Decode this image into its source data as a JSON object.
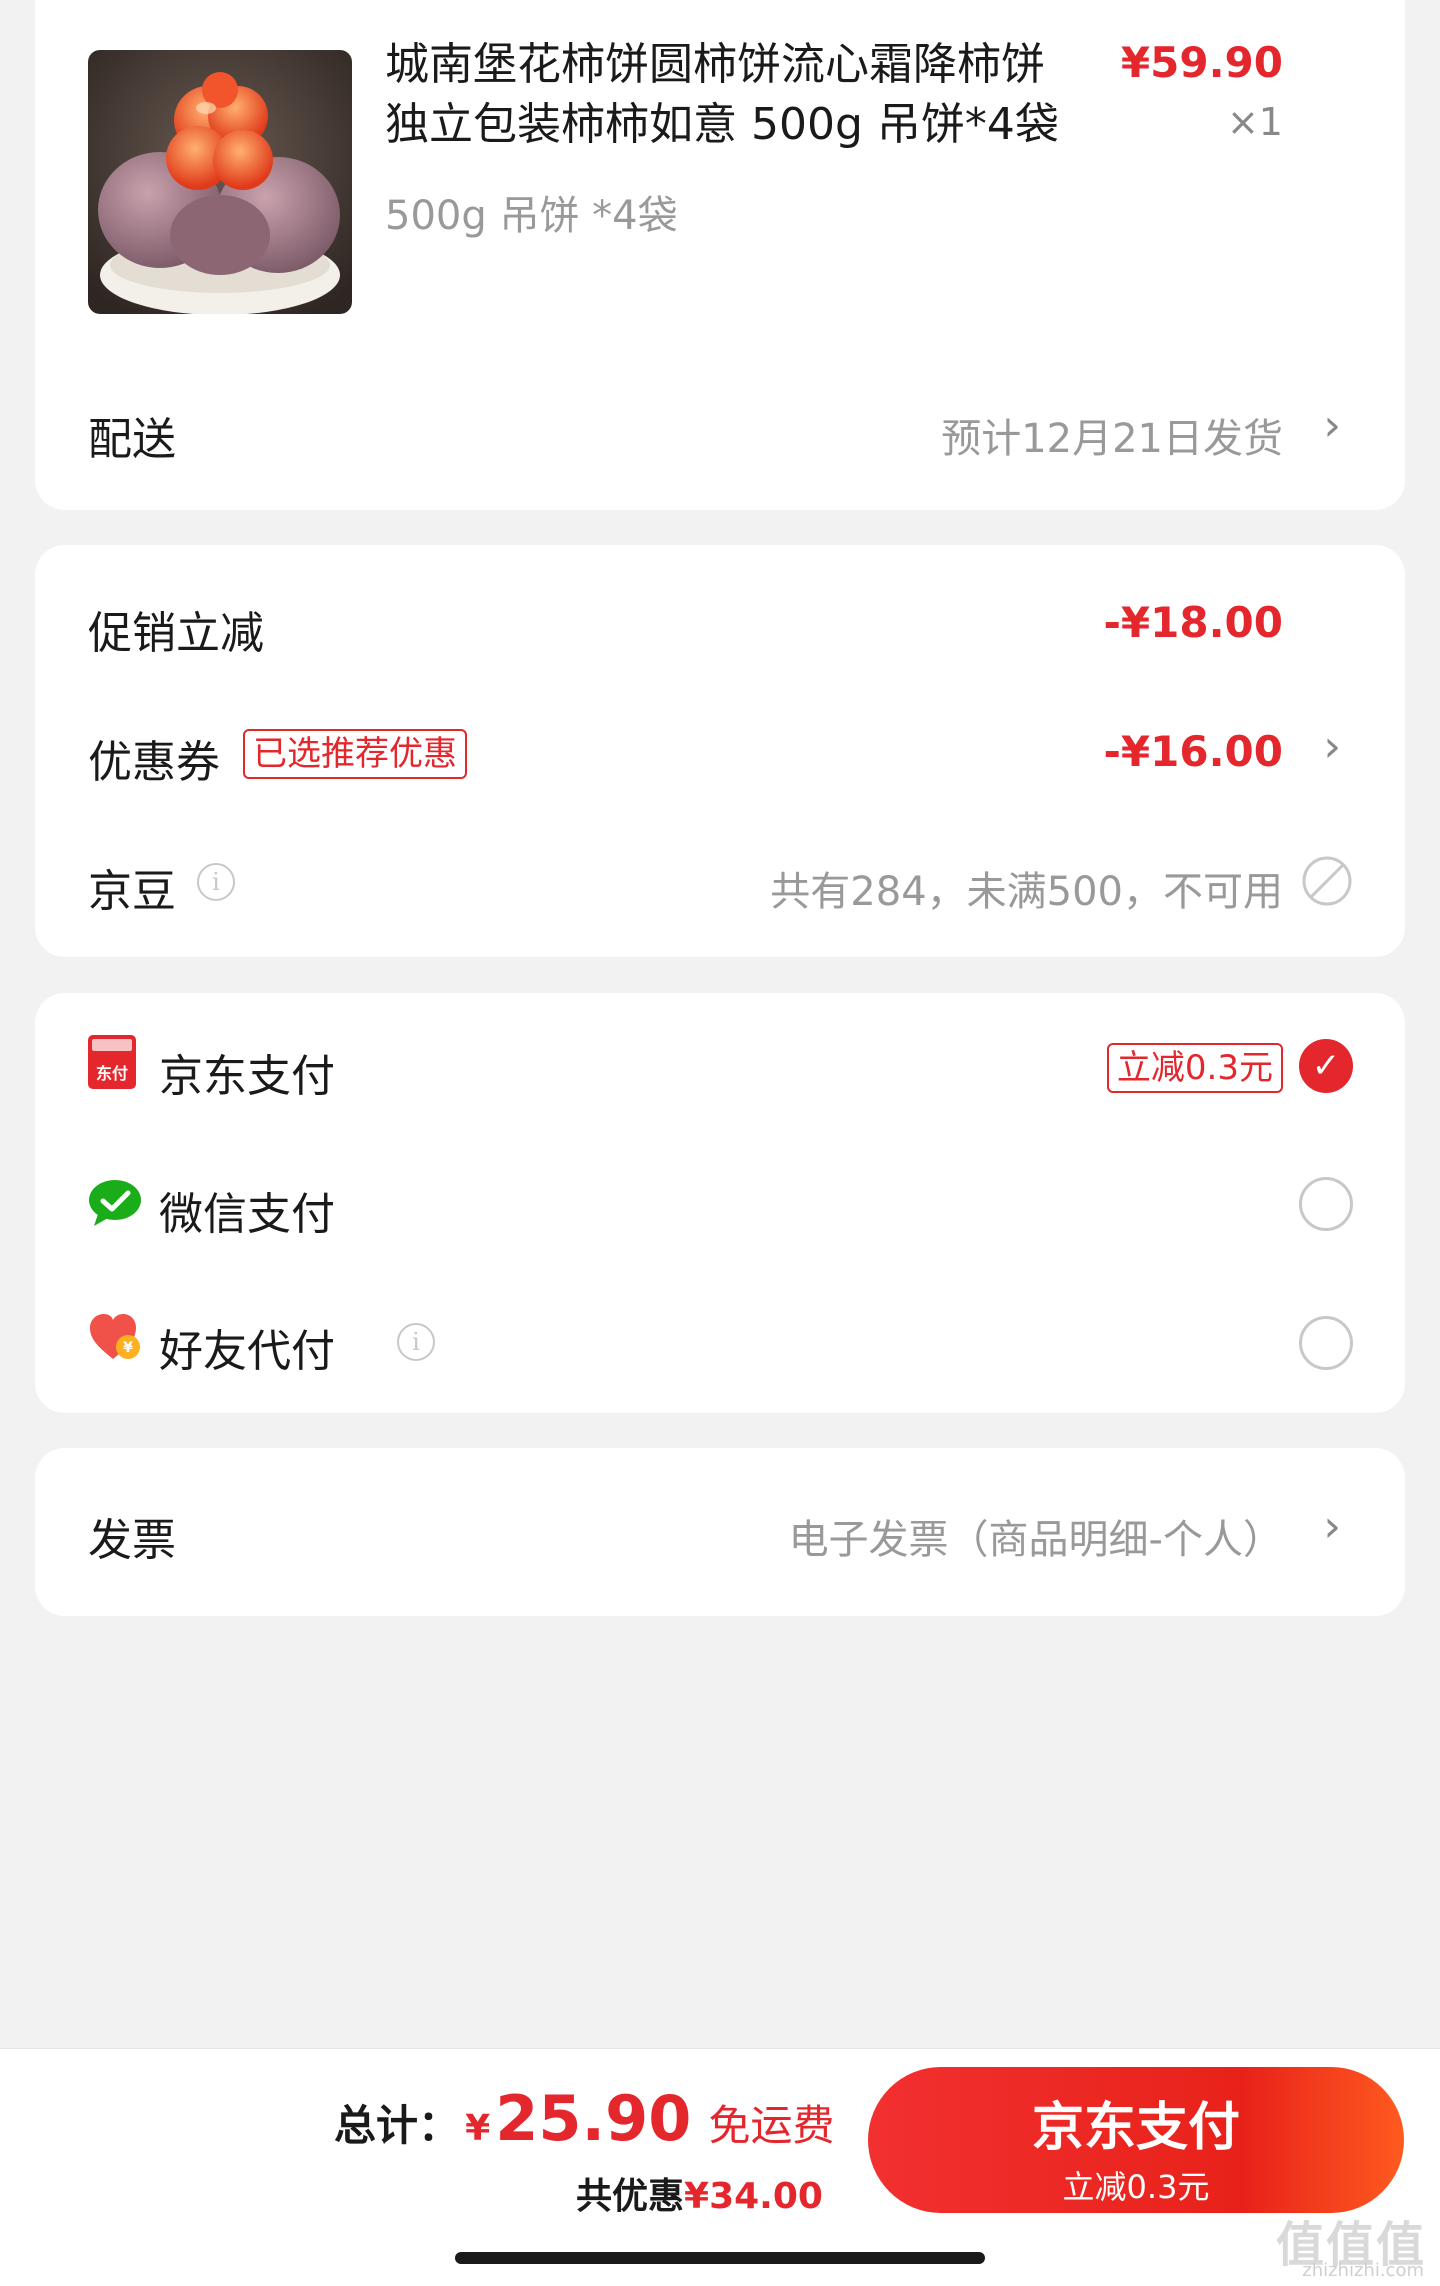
{
  "product": {
    "title": "城南堡花柿饼圆柿饼流心霜降柿饼独立包装柿柿如意 500g 吊饼*4袋",
    "price": "¥59.90",
    "qty": "×1",
    "spec": "500g 吊饼 *4袋",
    "image_icon": "persimmon-product-image"
  },
  "delivery": {
    "label": "配送",
    "value": "预计12月21日发货"
  },
  "discounts": {
    "promo_label": "促销立减",
    "promo_amount": "-¥18.00",
    "coupon_label": "优惠券",
    "coupon_tag": "已选推荐优惠",
    "coupon_amount": "-¥16.00",
    "jingdou_label": "京豆",
    "jingdou_value": "共有284，未满500，不可用"
  },
  "payment": {
    "jdpay_label": "京东支付",
    "jdpay_tag": "立减0.3元",
    "jdpay_icon_text": "东付",
    "wechat_label": "微信支付",
    "friend_label": "好友代付"
  },
  "invoice": {
    "label": "发票",
    "value": "电子发票（商品明细-个人）"
  },
  "footer": {
    "total_label": "总计：",
    "currency": "¥",
    "total_amount": "25.90",
    "free_shipping": "免运费",
    "saved_label": "共优惠",
    "saved_amount": "¥34.00",
    "pay_button": "京东支付",
    "pay_button_sub": "立减0.3元"
  },
  "watermark": {
    "main": "值值值",
    "sub": "zhizhizhi.com"
  },
  "colors": {
    "accent": "#e4262d",
    "background": "#f2f2f2",
    "wechat_green": "#1aad19"
  }
}
